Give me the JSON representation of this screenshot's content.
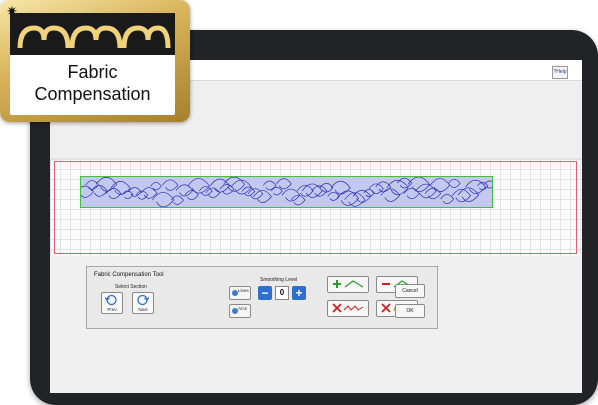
{
  "badge": {
    "line1": "Fabric",
    "line2": "Compensation",
    "icon": "hearts-logo-icon",
    "colors": {
      "gold": "#c9a24a",
      "band": "#1a1a1a"
    }
  },
  "window": {
    "help_label": "Help",
    "help_icon": "question-icon"
  },
  "panel": {
    "title": "Fabric Compensation Tool",
    "select_section_label": "Select Section",
    "prev_label": "Prev",
    "next_label": "Next",
    "lines_label": "Lines",
    "arcs_label": "Arcs",
    "smoothing_label": "Smoothing Level",
    "smoothing_value": "0",
    "minus_symbol": "−",
    "plus_symbol": "+",
    "cancel_label": "Cancel",
    "ok_label": "OK"
  },
  "colors": {
    "accent": "#2d6fd0",
    "canvas_border": "#e06070",
    "quilt_fill": "#c3c8ef",
    "quilt_stroke": "#2a2fb8",
    "quilt_outline": "#44bb44"
  }
}
